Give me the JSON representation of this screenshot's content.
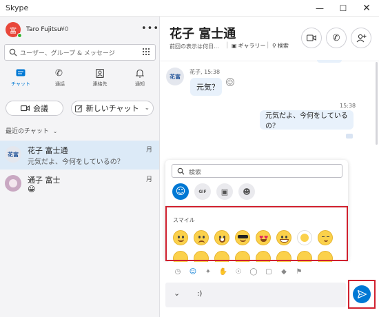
{
  "window": {
    "title": "Skype"
  },
  "profile": {
    "name": "Taro Fujitsu",
    "credit": "¥0",
    "avatar_text": "富"
  },
  "search": {
    "placeholder": "ユーザー、グループ & メッセージ"
  },
  "nav": [
    {
      "label": "チャット",
      "icon": "chat-icon",
      "active": true
    },
    {
      "label": "通話",
      "icon": "phone-icon",
      "active": false
    },
    {
      "label": "連絡先",
      "icon": "contacts-icon",
      "active": false
    },
    {
      "label": "通知",
      "icon": "bell-icon",
      "active": false
    }
  ],
  "actions": {
    "meeting": "会議",
    "new_chat": "新しいチャット"
  },
  "recent": {
    "header": "最近のチャット"
  },
  "chats": [
    {
      "avatar_text": "花富",
      "name": "花子 富士通",
      "preview": "元気だよ、今何をしているの？",
      "day": "月",
      "selected": true
    },
    {
      "avatar_text": "",
      "name": "通子 富士",
      "preview": "😀",
      "day": "月",
      "selected": false
    }
  ],
  "conversation": {
    "title": "花子 富士通",
    "subtitle": "前回の表示は何日...",
    "gallery": "ギャラリー",
    "find": "検索"
  },
  "messages": [
    {
      "sender": "花子",
      "time": "15:38",
      "text": "元気？",
      "avatar_text": "花富",
      "incoming": true
    },
    {
      "time": "15:38",
      "text": "元気だよ、今何をしているの？",
      "incoming": false
    }
  ],
  "emoji_panel": {
    "search_placeholder": "検索",
    "section_title": "スマイル",
    "accent": "#0078d4",
    "highlight": "#d0202e"
  },
  "composer": {
    "value": ":)"
  }
}
